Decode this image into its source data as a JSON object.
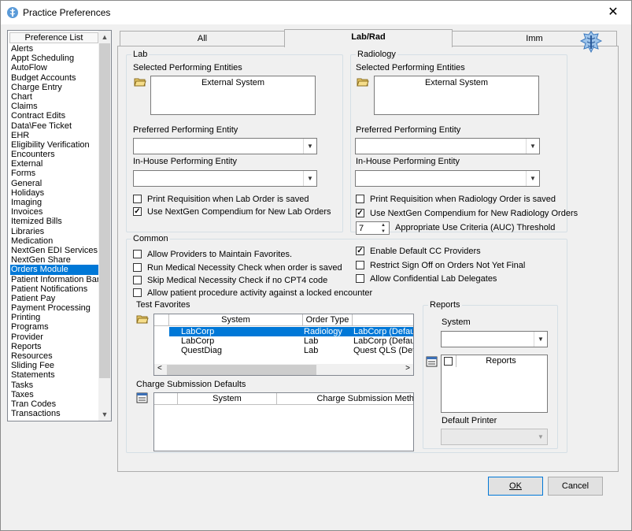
{
  "window": {
    "title": "Practice Preferences",
    "close_glyph": "✕"
  },
  "preference_list": {
    "header": "Preference List",
    "items": [
      "Alerts",
      "Appt Scheduling",
      "AutoFlow",
      "Budget Accounts",
      "Charge Entry",
      "Chart",
      "Claims",
      "Contract Edits",
      "Data\\Fee Ticket",
      "EHR",
      "Eligibility Verification",
      "Encounters",
      "External",
      "Forms",
      "General",
      "Holidays",
      "Imaging",
      "Invoices",
      "Itemized Bills",
      "Libraries",
      "Medication",
      "NextGen EDI Services",
      "NextGen Share",
      "Orders Module",
      "Patient Information Bar",
      "Patient Notifications",
      "Patient Pay",
      "Payment Processing",
      "Printing",
      "Programs",
      "Provider",
      "Reports",
      "Resources",
      "Sliding Fee",
      "Statements",
      "Tasks",
      "Taxes",
      "Tran Codes",
      "Transactions"
    ],
    "selected": "Orders Module"
  },
  "tabs": [
    {
      "label": "All"
    },
    {
      "label": "Lab/Rad"
    },
    {
      "label": "Imm"
    }
  ],
  "lab": {
    "title": "Lab",
    "selected_entities_label": "Selected Performing Entities",
    "entities_header": "External System",
    "preferred_label": "Preferred Performing Entity",
    "inhouse_label": "In-House Performing Entity",
    "print_req_label": "Print Requisition when Lab Order is saved",
    "print_req_checked": false,
    "compendium_label": "Use NextGen Compendium for New Lab Orders",
    "compendium_checked": true
  },
  "radiology": {
    "title": "Radiology",
    "selected_entities_label": "Selected Performing Entities",
    "entities_header": "External System",
    "preferred_label": "Preferred Performing Entity",
    "inhouse_label": "In-House Performing Entity",
    "print_req_label": "Print Requisition when Radiology Order is saved",
    "print_req_checked": false,
    "compendium_label": "Use NextGen Compendium for New Radiology Orders",
    "compendium_checked": true,
    "auc_value": "7",
    "auc_label": "Appropriate Use Criteria (AUC) Threshold"
  },
  "common": {
    "title": "Common",
    "opt1": "Allow Providers to Maintain Favorites.",
    "opt2": "Run Medical Necessity Check when order is saved",
    "opt3": "Skip Medical Necessity Check if no CPT4 code",
    "opt4": "Allow patient procedure activity against a locked encounter",
    "opt5": "Enable Default CC Providers",
    "opt5_checked": true,
    "opt6": "Restrict Sign Off on Orders Not Yet Final",
    "opt7": "Allow Confidential Lab Delegates",
    "check_mark": "✓"
  },
  "test_favorites": {
    "label": "Test Favorites",
    "columns": [
      "System",
      "Order Type",
      ""
    ],
    "rows": [
      {
        "system": "LabCorp",
        "type": "Radiology",
        "name": "LabCorp (Default)"
      },
      {
        "system": "LabCorp",
        "type": "Lab",
        "name": "LabCorp (Default)"
      },
      {
        "system": "QuestDiag",
        "type": "Lab",
        "name": "Quest QLS (Default)"
      }
    ]
  },
  "charge_submission": {
    "label": "Charge Submission Defaults",
    "columns": [
      "System",
      "Charge Submission Meth"
    ]
  },
  "reports": {
    "title": "Reports",
    "system_label": "System",
    "list_header": "Reports",
    "default_printer_label": "Default Printer"
  },
  "buttons": {
    "ok": "OK",
    "cancel": "Cancel"
  },
  "icons": {
    "folder": "folder-open-icon",
    "dropdown": "chevron-down-icon",
    "caduceus": "caduceus-icon"
  },
  "colors": {
    "selection": "#0078d7",
    "window_bg": "#f0f0f0"
  }
}
